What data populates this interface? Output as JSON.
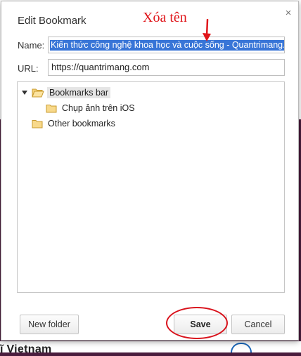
{
  "background": {
    "bottom_text": "ĩ Vietnam"
  },
  "dialog": {
    "title": "Edit Bookmark",
    "close_glyph": "×",
    "name_label": "Name:",
    "name_value": "Kiến thức công nghệ khoa học và cuộc sống - Quantrimang.com",
    "url_label": "URL:",
    "url_value": "https://quantrimang.com",
    "tree": {
      "root": "Bookmarks bar",
      "child": "Chụp ảnh trên iOS",
      "other": "Other bookmarks"
    },
    "buttons": {
      "new_folder": "New folder",
      "save": "Save",
      "cancel": "Cancel"
    }
  },
  "annotation": {
    "text": "Xóa tên",
    "color": "#e0161b"
  },
  "colors": {
    "selection": "#3875d7",
    "annotation_red": "#d9111b",
    "backdrop": "#4a1c3d"
  }
}
